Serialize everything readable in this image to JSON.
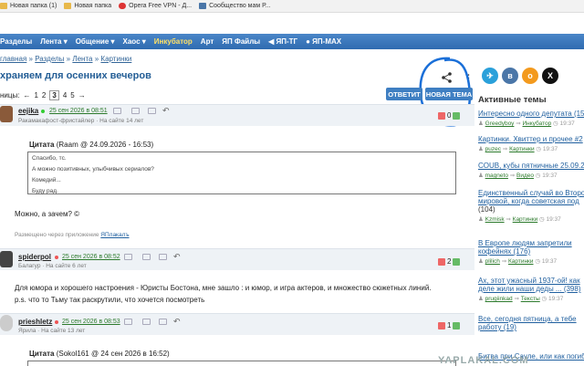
{
  "bookmarks": [
    "Новая папка (1)",
    "Новая папка",
    "Opera Free VPN - Д...",
    "Сообщество мам Р..."
  ],
  "nav": [
    "Разделы",
    "Лента ▾",
    "Общение ▾",
    "Хаос ▾",
    "Инкубатор",
    "Арт",
    "ЯП Файлы",
    "◀ ЯП-ТГ",
    "● ЯП-MAX"
  ],
  "breadcrumb": {
    "a": "главная",
    "b": "Разделы",
    "c": "Лента",
    "d": "Картинки",
    "sep": "»"
  },
  "title": "храняем для осенних вечеров",
  "pages": {
    "label": "ницы:",
    "prev": "←",
    "items": [
      "1",
      "2",
      "3",
      "4",
      "5"
    ],
    "next": "→"
  },
  "buttons": {
    "reply": "ОТВЕТИТ",
    "new_topic": "НОВАЯ ТЕМА"
  },
  "posts": [
    {
      "name": "eejika",
      "date": "25 сен 2026 в 08:51",
      "status": "Ракамакафост-фристайлер  ·  На сайте 14 лет",
      "votes": "0"
    },
    {
      "name": "spiderpol",
      "date": "25 сен 2026 в 08:52",
      "status": "Балагур  ·  На сайте 6 лет",
      "votes": "2"
    },
    {
      "name": "prieshletz",
      "date": "25 сен 2026 в 08:53",
      "status": "Ярила  ·  На сайте 13 лет",
      "votes": "1"
    }
  ],
  "quote1": {
    "title": "Цитата",
    "src": "(Raam @ 24.09.2026 - 16:53)",
    "lines": [
      "Спасибо, тс.",
      "А можно позитивных, улыбчивых сериалов?",
      "Комедий...",
      "Буду рад."
    ]
  },
  "post1_text": "Можно, а зачем? ©",
  "post1_via": "Размещено через приложение ",
  "post1_app": "ЯПлакалъ",
  "post2_text": "Для юмора и хорошего настроения - Юристы Бостона, мне зашло : и юмор, и игра актеров, и множество сюжетных линий.",
  "post2_text2": "p.s. что то Тьму так раскрутили, что хочется посмотреть",
  "quote3": {
    "title": "Цитата",
    "src": "(Sokol161 @ 24 сен 2026 в 16:52)"
  },
  "sidebar": {
    "heading": "Активные темы",
    "social": [
      "✈",
      "в",
      "о",
      "X"
    ],
    "topics": [
      {
        "t": "Интересно одного депутата (15",
        "u": "Greedyboy",
        "s": "Инкубатор",
        "time": "19:37"
      },
      {
        "t": "Картинки. Хвиттер и прочее #2",
        "u": "puzec",
        "s": "Картинки",
        "time": "19:37"
      },
      {
        "t": "COUB, кубы пятничные 25.09.2",
        "u": "magneto",
        "s": "Видео",
        "time": "19:37"
      },
      {
        "t": "Единственный случай во Второ",
        "t2": "мировой, когда советская под",
        "t3": "(104)",
        "u": "Kzmisk",
        "s": "Картинки",
        "time": "19:37"
      },
      {
        "t": "В Европе людям запретили",
        "t2": "кофейнях (176)",
        "u": "plilich",
        "s": "Картинки",
        "time": "19:37"
      },
      {
        "t": "Ах, этот ужасный 1937-ой! как",
        "t2": "деле жили наши деды ... (398)",
        "u": "prugiinkad",
        "s": "Тексты",
        "time": "19:37"
      },
      {
        "t": "Все, сегодня пятница, а тебе",
        "t2": "работу (19)",
        "u": "",
        "s": "",
        "time": ""
      },
      {
        "t": "Битва при Сауле, или как погиб",
        "u": "",
        "s": "",
        "time": ""
      }
    ]
  },
  "watermark": "YAPLAKAL.COM",
  "colors": {
    "nav": "#3a78bd",
    "link": "#1f5f9f",
    "accent": "#2c7a2c"
  }
}
